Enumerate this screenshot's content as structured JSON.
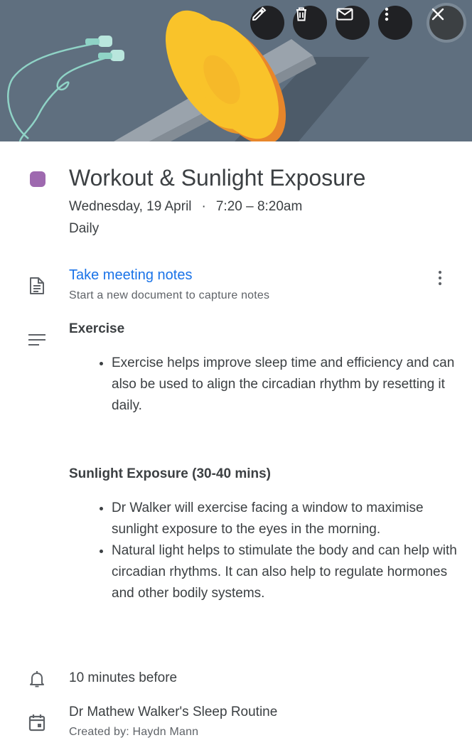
{
  "event": {
    "color": "#9e69af",
    "title": "Workout & Sunlight Exposure",
    "date": "Wednesday, 19 April",
    "separator": "·",
    "time": "7:20 – 8:20am",
    "recurrence": "Daily"
  },
  "toolbar": {
    "buttons": [
      {
        "icon": "pencil-icon"
      },
      {
        "icon": "trash-icon"
      },
      {
        "icon": "mail-icon"
      },
      {
        "icon": "more-vert-icon"
      },
      {
        "icon": "close-icon"
      }
    ]
  },
  "notes": {
    "link": "Take meeting notes",
    "subtitle": "Start a new document to capture notes"
  },
  "description": {
    "sections": [
      {
        "heading": "Exercise",
        "bullets": [
          "Exercise helps improve sleep time and efficiency and can also be used to align the circadian rhythm by resetting it daily."
        ]
      },
      {
        "heading": "Sunlight Exposure (30-40 mins)",
        "bullets": [
          "Dr Walker will exercise facing a window to maximise sunlight exposure to the eyes in the morning.",
          "Natural light helps to stimulate the body and can help with circadian rhythms. It can also help to regulate hormones and other bodily systems."
        ]
      }
    ]
  },
  "reminder": "10 minutes before",
  "calendar": {
    "name": "Dr Mathew Walker's Sleep Routine",
    "creator": "Created by: Haydn Mann"
  }
}
